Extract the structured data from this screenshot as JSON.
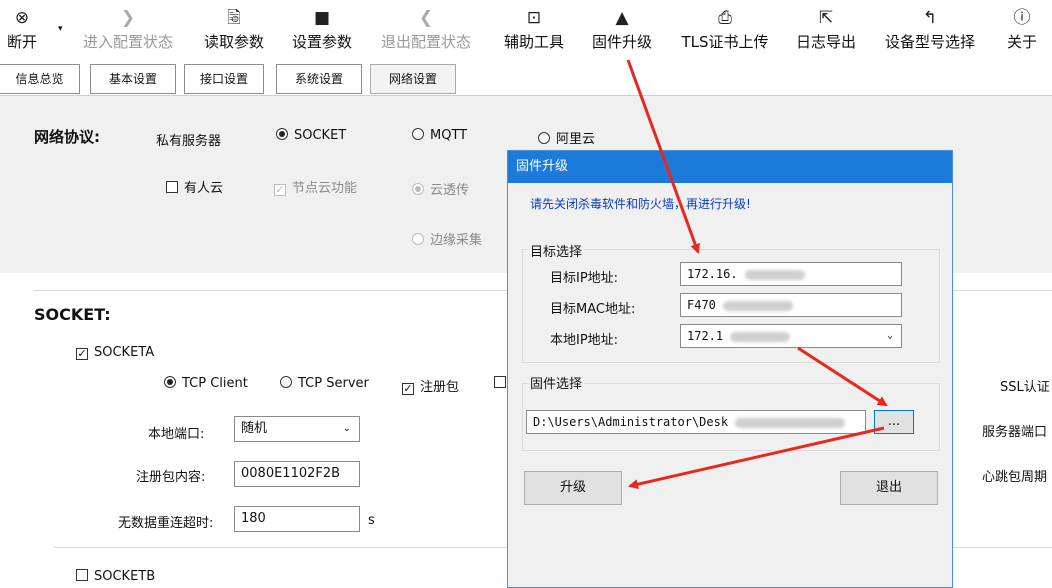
{
  "toolbar": {
    "items": [
      {
        "label": "断开",
        "icon": "close-circle-icon",
        "disabled": false
      },
      {
        "label": "进入配置状态",
        "icon": "chevron-right-icon",
        "disabled": true
      },
      {
        "label": "读取参数",
        "icon": "read-params-icon",
        "disabled": false
      },
      {
        "label": "设置参数",
        "icon": "save-icon",
        "disabled": false
      },
      {
        "label": "退出配置状态",
        "icon": "chevron-left-icon",
        "disabled": true
      },
      {
        "label": "辅助工具",
        "icon": "tools-icon",
        "disabled": false
      },
      {
        "label": "固件升级",
        "icon": "rocket-icon",
        "disabled": false
      },
      {
        "label": "TLS证书上传",
        "icon": "certificate-icon",
        "disabled": false
      },
      {
        "label": "日志导出",
        "icon": "export-icon",
        "disabled": false
      },
      {
        "label": "设备型号选择",
        "icon": "reply-arrow-icon",
        "disabled": false
      },
      {
        "label": "关于",
        "icon": "info-icon",
        "disabled": false
      }
    ]
  },
  "tabs": [
    "信息总览",
    "基本设置",
    "接口设置",
    "系统设置",
    "网络设置"
  ],
  "network": {
    "title": "网络协议:",
    "private_server": "私有服务器",
    "socket": "SOCKET",
    "mqtt": "MQTT",
    "aliyun": "阿里云",
    "youren": "有人云",
    "node_cloud": "节点云功能",
    "cloud_pass": "云透传",
    "edge": "边缘采集"
  },
  "socket": {
    "title": "SOCKET:",
    "a_label": "SOCKETA",
    "tcp_client": "TCP Client",
    "tcp_server": "TCP Server",
    "register": "注册包",
    "ssl": "SSL认证",
    "local_port_label": "本地端口:",
    "local_port_value": "随机",
    "server_port_label": "服务器端口",
    "reg_content_label": "注册包内容:",
    "reg_content_value": "0080E1102F2B",
    "heartbeat_label": "心跳包周期",
    "reconnect_label": "无数据重连超时:",
    "reconnect_value": "180",
    "reconnect_unit": "s",
    "b_label": "SOCKETB"
  },
  "dialog": {
    "title": "固件升级",
    "warning": "请先关闭杀毒软件和防火墙，再进行升级!",
    "target_group": "目标选择",
    "target_ip_label": "目标IP地址:",
    "target_ip_value": "172.16.",
    "target_mac_label": "目标MAC地址:",
    "target_mac_value": "F470",
    "local_ip_label": "本地IP地址:",
    "local_ip_value": "172.1",
    "firmware_group": "固件选择",
    "firmware_path": "D:\\Users\\Administrator\\Desk",
    "browse": "...",
    "upgrade": "升级",
    "exit": "退出"
  },
  "colors": {
    "title_bar": "#1c7ad8",
    "warning_text": "#0a3cbf",
    "arrow": "#e8281e"
  }
}
